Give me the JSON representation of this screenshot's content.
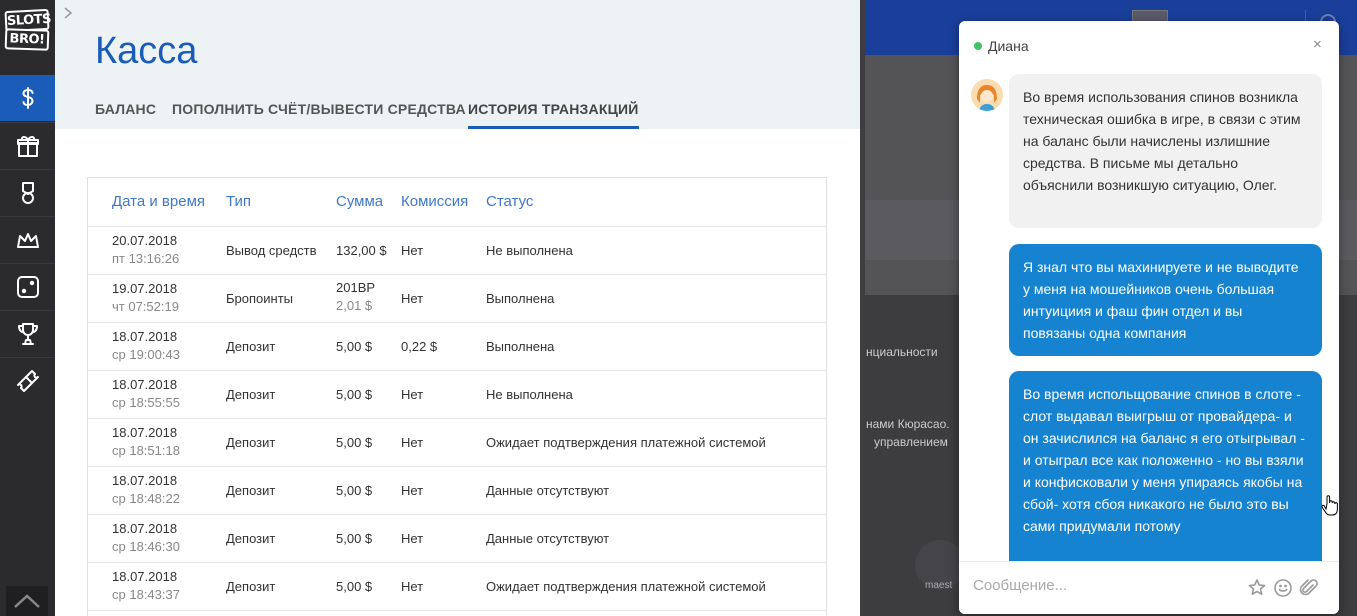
{
  "brand": {
    "logo_line1": "SLOTS",
    "logo_line2": "BRO!"
  },
  "sidebar": {
    "items": [
      {
        "icon": "dollar-icon",
        "active": true
      },
      {
        "icon": "gift-icon",
        "active": false
      },
      {
        "icon": "medal-icon",
        "active": false
      },
      {
        "icon": "crown-icon",
        "active": false
      },
      {
        "icon": "dice-icon",
        "active": false
      },
      {
        "icon": "trophy-icon",
        "active": false
      },
      {
        "icon": "ticket-icon",
        "active": false
      }
    ]
  },
  "cashier": {
    "title": "Касса",
    "tabs": [
      "БАЛАНС",
      "ПОПОЛНИТЬ СЧЁТ/ВЫВЕСТИ СРЕДСТВА",
      "ИСТОРИЯ ТРАНЗАКЦИЙ"
    ],
    "active_tab": 2,
    "table": {
      "headers": [
        "Дата и время",
        "Тип",
        "Сумма",
        "Комиссия",
        "Статус"
      ],
      "rows": [
        {
          "date": "20.07.2018",
          "time": "пт 13:16:26",
          "type": "Вывод средств",
          "amount": "132,00 $",
          "amount_sub": "",
          "fee": "Нет",
          "status": "Не выполнена"
        },
        {
          "date": "19.07.2018",
          "time": "чт 07:52:19",
          "type": "Бропоинты",
          "amount": "201BP",
          "amount_sub": "2,01 $",
          "fee": "Нет",
          "status": "Выполнена"
        },
        {
          "date": "18.07.2018",
          "time": "ср 19:00:43",
          "type": "Депозит",
          "amount": "5,00 $",
          "amount_sub": "",
          "fee": "0,22 $",
          "status": "Выполнена"
        },
        {
          "date": "18.07.2018",
          "time": "ср 18:55:55",
          "type": "Депозит",
          "amount": "5,00 $",
          "amount_sub": "",
          "fee": "Нет",
          "status": "Не выполнена"
        },
        {
          "date": "18.07.2018",
          "time": "ср 18:51:18",
          "type": "Депозит",
          "amount": "5,00 $",
          "amount_sub": "",
          "fee": "Нет",
          "status": "Ожидает подтверждения платежной системой"
        },
        {
          "date": "18.07.2018",
          "time": "ср 18:48:22",
          "type": "Депозит",
          "amount": "5,00 $",
          "amount_sub": "",
          "fee": "Нет",
          "status": "Данные отсутствуют"
        },
        {
          "date": "18.07.2018",
          "time": "ср 18:46:30",
          "type": "Депозит",
          "amount": "5,00 $",
          "amount_sub": "",
          "fee": "Нет",
          "status": "Данные отсутствуют"
        },
        {
          "date": "18.07.2018",
          "time": "ср 18:43:37",
          "type": "Депозит",
          "amount": "5,00 $",
          "amount_sub": "",
          "fee": "Нет",
          "status": "Ожидает подтверждения платежной системой"
        }
      ]
    }
  },
  "background": {
    "text1": "нциальности",
    "text2": "нами Кюрасао.",
    "text3": "управлением",
    "text4": "maest"
  },
  "chat": {
    "agent_name": "Диана",
    "online_color": "#43c167",
    "close_label": "×",
    "messages": [
      {
        "from": "agent",
        "text": "Во время использования спинов возникла техническая ошибка в игре, в связи с этим на баланс были начислены излишние средства. В письме мы детально объяснили возникшую ситуацию, Олег."
      },
      {
        "from": "user",
        "text": "Я знал  что вы  махинируете  и не выводите у меня на  мошейников очень большая  интуициия  и фаш  фин отдел  и  вы повязаны  одна   компания"
      },
      {
        "from": "user",
        "text": "Во время  испольщование  спинов в слоте  -  слот выдавал  выигрыш  от провайдера- и  он зачислился  на баланс  я  его отыгрывал  - и отыграл все  как  положенно -  но вы  взяли  и конфисковали  у меня   упираясь якобы  на сбой- хотя  сбоя  никакого не было  это вы сами  придумали потому"
      }
    ],
    "input_placeholder": "Сообщение...",
    "accent_color": "#1583d0"
  }
}
